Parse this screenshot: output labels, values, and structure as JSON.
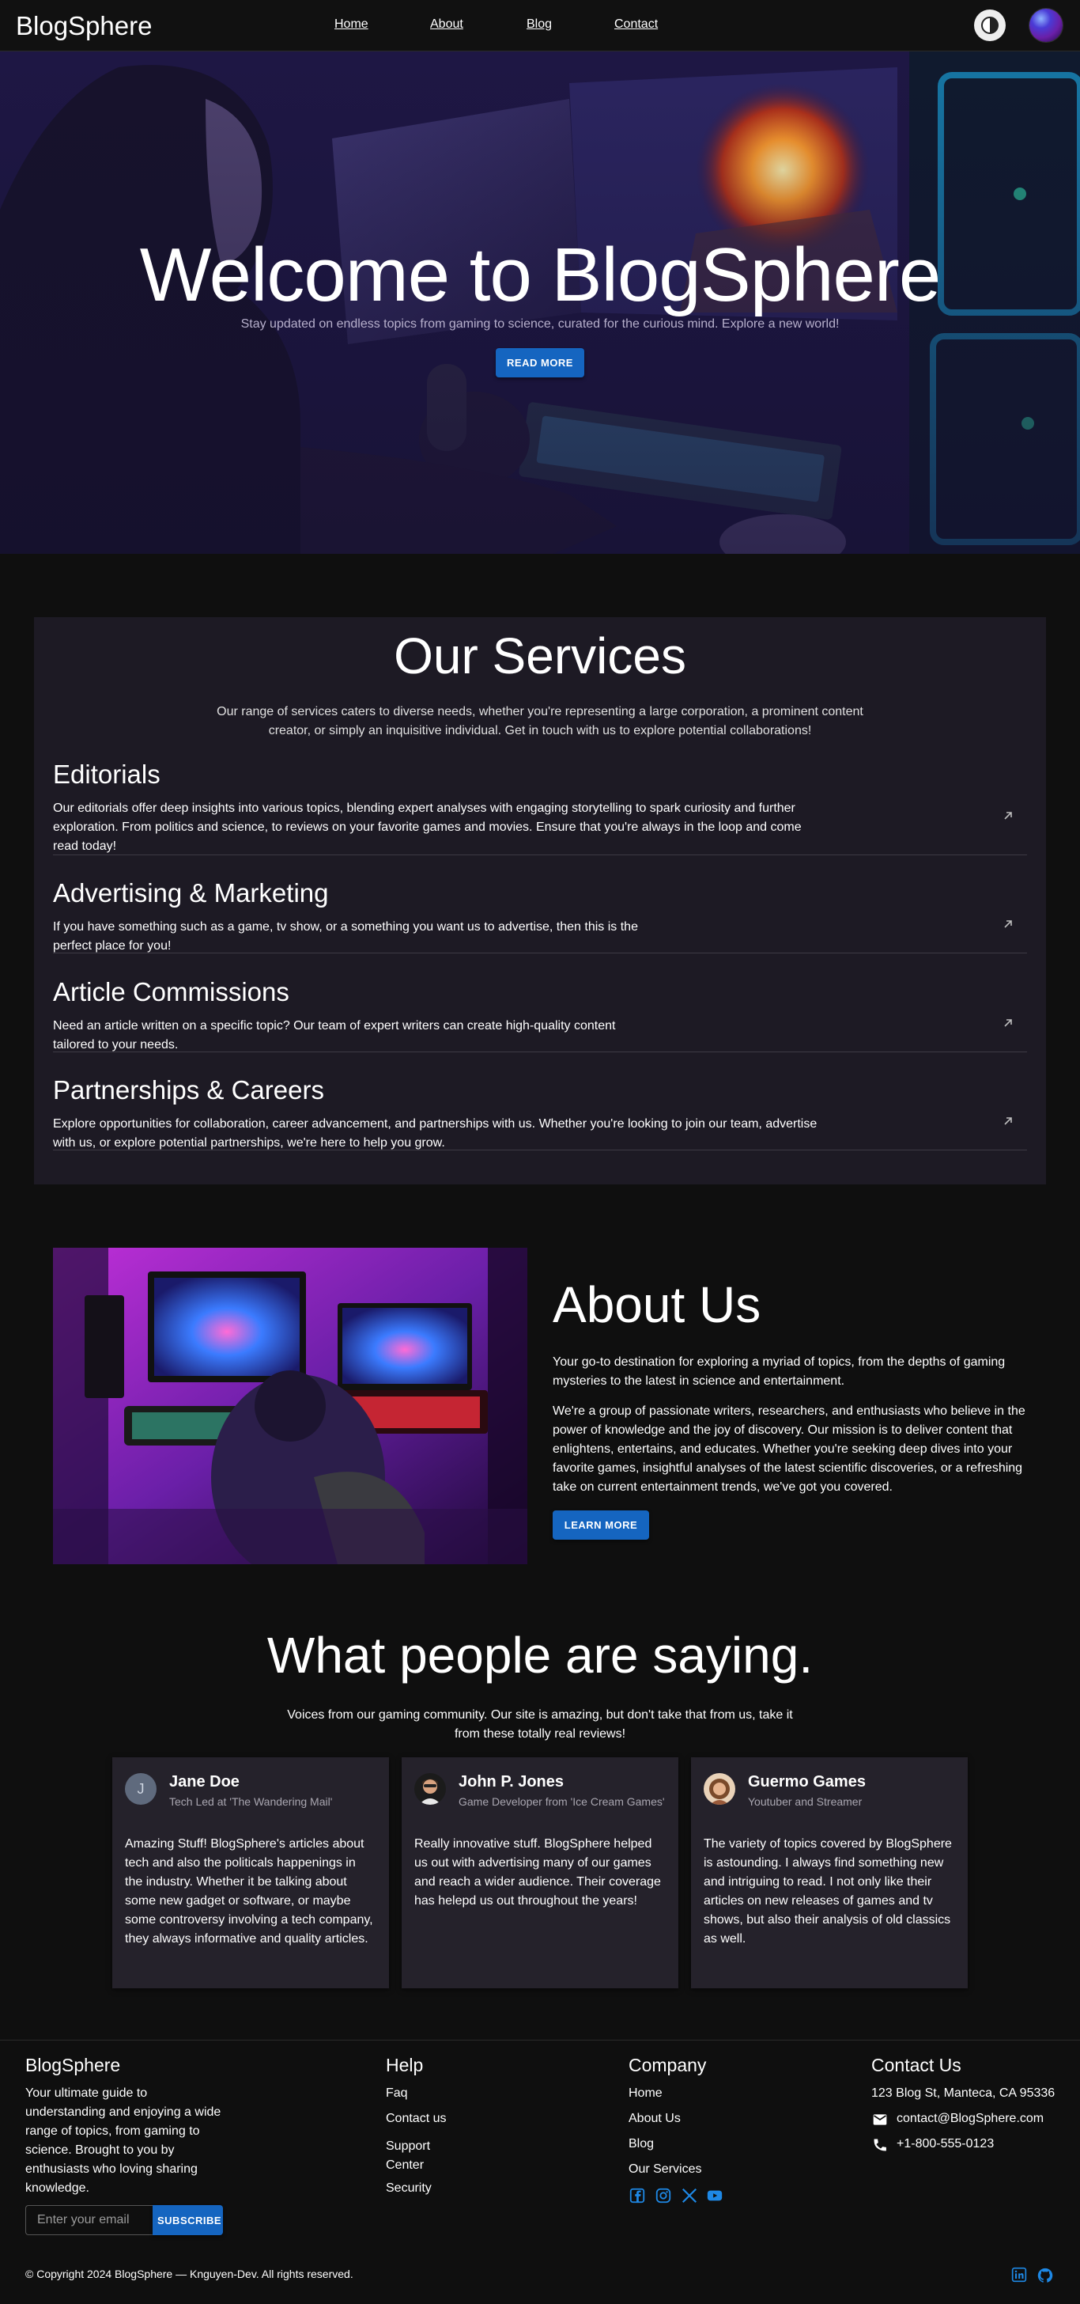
{
  "nav": {
    "brand": "BlogSphere",
    "links": [
      "Home",
      "About",
      "Blog",
      "Contact"
    ]
  },
  "hero": {
    "title": "Welcome to BlogSphere",
    "subtitle": "Stay updated on endless topics from gaming to science, curated for the curious mind. Explore a new world!",
    "button": "READ MORE"
  },
  "services": {
    "title": "Our Services",
    "intro": "Our range of services caters to diverse needs, whether you're representing a large corporation, a prominent content creator, or simply an inquisitive individual. Get in touch with us to explore potential collaborations!",
    "items": [
      {
        "title": "Editorials",
        "desc": "Our editorials offer deep insights into various topics, blending expert analyses with engaging storytelling to spark curiosity and further exploration. From politics and science, to reviews on your favorite games and movies. Ensure that you're always in the loop and come read today!"
      },
      {
        "title": "Advertising & Marketing",
        "desc": "If you have something such as a game, tv show, or a something you want us to advertise, then this is the perfect place for you!"
      },
      {
        "title": "Article Commissions",
        "desc": "Need an article written on a specific topic? Our team of expert writers can create high-quality content tailored to your needs."
      },
      {
        "title": "Partnerships & Careers",
        "desc": "Explore opportunities for collaboration, career advancement, and partnerships with us. Whether you're looking to join our team, advertise with us, or explore potential partnerships, we're here to help you grow."
      }
    ]
  },
  "about": {
    "title": "About Us",
    "p1": "Your go-to destination for exploring a myriad of topics, from the depths of gaming mysteries to the latest in science and entertainment.",
    "p2": "We're a group of passionate writers, researchers, and enthusiasts who believe in the power of knowledge and the joy of discovery. Our mission is to deliver content that enlightens, entertains, and educates. Whether you're seeking deep dives into your favorite games, insightful analyses of the latest scientific discoveries, or a refreshing take on current entertainment trends, we've got you covered.",
    "button": "LEARN MORE"
  },
  "testimonials": {
    "title": "What people are saying.",
    "subtitle": "Voices from our gaming community. Our site is amazing, but don't take that from us, take it from these totally real reviews!",
    "cards": [
      {
        "initial": "J",
        "name": "Jane Doe",
        "role": "Tech Led at 'The Wandering Mail'",
        "text": "Amazing Stuff! BlogSphere's articles about tech and also the politicals happenings in the industry. Whether it be talking about some new gadget or software, or maybe some controversy involving a tech company, they always informative and quality articles."
      },
      {
        "name": "John P. Jones",
        "role": "Game Developer from 'Ice Cream Games'",
        "text": "Really innovative stuff. BlogSphere helped us out with advertising many of our games and reach a wider audience. Their coverage has helepd us out throughout the years!"
      },
      {
        "name": "Guermo Games",
        "role": "Youtuber and Streamer",
        "text": "The variety of topics covered by BlogSphere is astounding. I always find something new and intriguing to read. I not only like their articles on new releases of games and tv shows, but also their analysis of old classics as well."
      }
    ]
  },
  "footer": {
    "brand": "BlogSphere",
    "tagline": "Your ultimate guide to understanding and enjoying a wide range of topics, from gaming to science. Brought to you by enthusiasts who loving sharing knowledge.",
    "email_placeholder": "Enter your email",
    "subscribe": "SUBSCRIBE",
    "help": {
      "title": "Help",
      "links": [
        "Faq",
        "Contact us",
        "Support Center",
        "Security"
      ]
    },
    "company": {
      "title": "Company",
      "links": [
        "Home",
        "About Us",
        "Blog",
        "Our Services"
      ]
    },
    "contact": {
      "title": "Contact Us",
      "address": "123 Blog St, Manteca, CA 95336",
      "email": "contact@BlogSphere.com",
      "phone": "+1-800-555-0123"
    },
    "copyright": "© Copyright 2024 BlogSphere — Knguyen-Dev. All rights reserved."
  },
  "colors": {
    "accent": "#1565c0",
    "link_icon": "#1e88e5",
    "surface": "#1d1a24",
    "card": "#25222b",
    "background": "#0f0f0f"
  }
}
